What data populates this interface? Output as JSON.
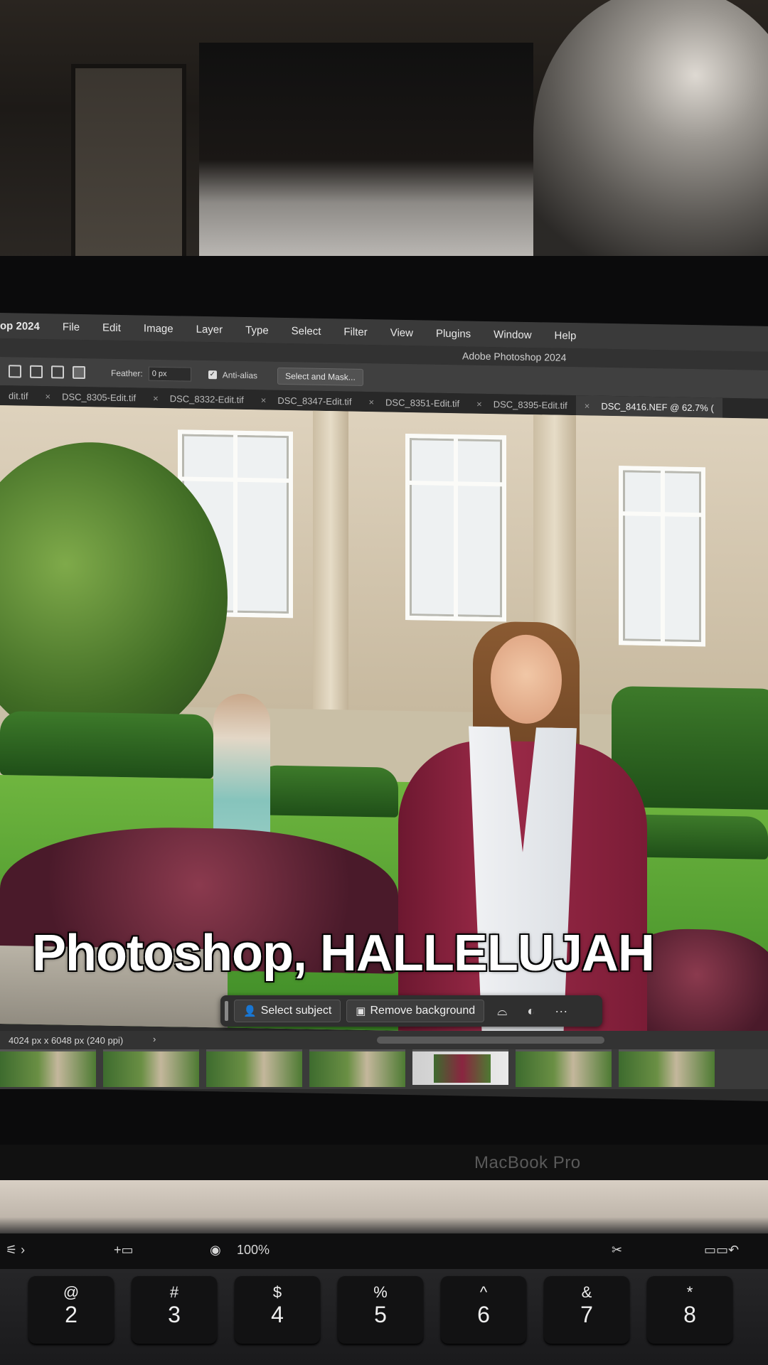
{
  "menu": {
    "app": "op 2024",
    "items": [
      "File",
      "Edit",
      "Image",
      "Layer",
      "Type",
      "Select",
      "Filter",
      "View",
      "Plugins",
      "Window",
      "Help"
    ]
  },
  "window_title": "Adobe Photoshop 2024",
  "options": {
    "feather_label": "Feather:",
    "feather_value": "0 px",
    "antialias_label": "Anti-alias",
    "select_mask_label": "Select and Mask..."
  },
  "tabs": [
    {
      "label": "dit.tif",
      "active": false
    },
    {
      "label": "DSC_8305-Edit.tif",
      "active": false
    },
    {
      "label": "DSC_8332-Edit.tif",
      "active": false
    },
    {
      "label": "DSC_8347-Edit.tif",
      "active": false
    },
    {
      "label": "DSC_8351-Edit.tif",
      "active": false
    },
    {
      "label": "DSC_8395-Edit.tif",
      "active": false
    },
    {
      "label": "DSC_8416.NEF @ 62.7% (",
      "active": true
    }
  ],
  "caption": "Photoshop, HALLELUJAH",
  "context_bar": {
    "select_subject": "Select subject",
    "remove_background": "Remove background"
  },
  "status": {
    "dimensions": "4024 px x 6048 px (240 ppi)",
    "arrow": "›"
  },
  "laptop_label": "MacBook Pro",
  "touchbar": {
    "zoom": "100%"
  },
  "keys": [
    {
      "sym": "@",
      "num": "2"
    },
    {
      "sym": "#",
      "num": "3"
    },
    {
      "sym": "$",
      "num": "4"
    },
    {
      "sym": "%",
      "num": "5"
    },
    {
      "sym": "^",
      "num": "6"
    },
    {
      "sym": "&",
      "num": "7"
    },
    {
      "sym": "*",
      "num": "8"
    }
  ]
}
